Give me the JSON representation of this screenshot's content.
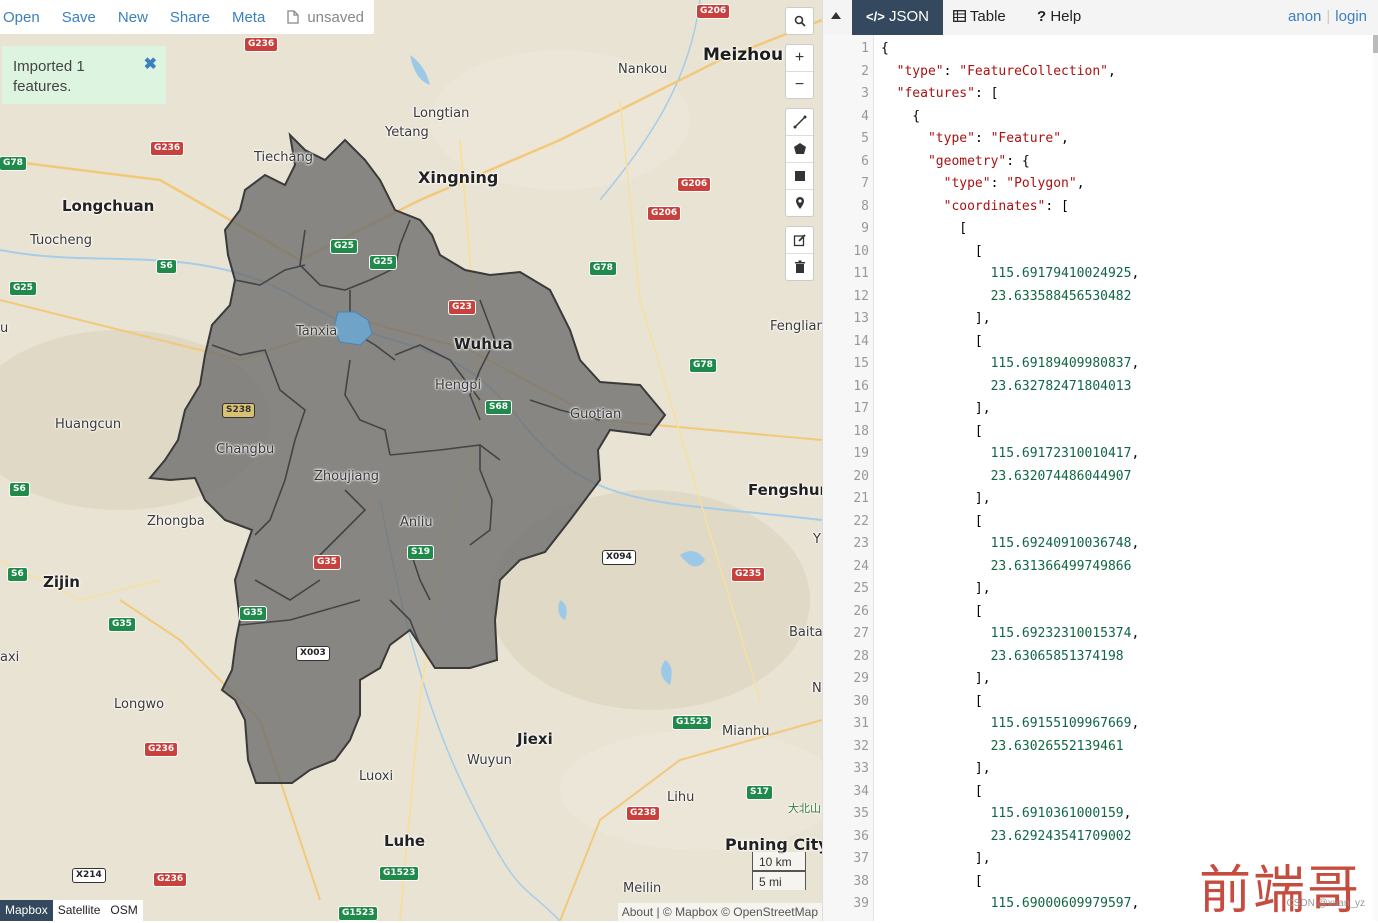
{
  "top_menu": {
    "items": [
      "Open",
      "Save",
      "New",
      "Share",
      "Meta"
    ],
    "file_status": "unsaved"
  },
  "notice": {
    "text": "Imported 1 features.",
    "close": "✖"
  },
  "map": {
    "places": {
      "meizhou": "Meizhou",
      "nankou": "Nankou",
      "longtian": "Longtian",
      "yetang": "Yetang",
      "tiechang": "Tiechang",
      "xingning": "Xingning",
      "longchuan": "Longchuan",
      "tuocheng": "Tuocheng",
      "tanxia": "Tanxia",
      "wuhua": "Wuhua",
      "hengpi": "Hengpi",
      "fengliang": "Fengliang",
      "guotian": "Guotian",
      "huangcun": "Huangcun",
      "changbu": "Changbu",
      "zhoujiang": "Zhoujiang",
      "fengshun": "Fengshun",
      "zhongba": "Zhongba",
      "anliu": "Anliu",
      "zijin": "Zijin",
      "baita": "Baita",
      "longwo": "Longwo",
      "mianhu": "Mianhu",
      "jiexi": "Jiexi",
      "wuyun": "Wuyun",
      "luoxi": "Luoxi",
      "lihu": "Lihu",
      "luhe": "Luhe",
      "puning": "Puning City",
      "meilin": "Meilin",
      "axi": "axi",
      "u": "u",
      "y": "Y",
      "n": "N",
      "dabeishan": "大北山"
    },
    "shields": {
      "g206a": "G206",
      "g236a": "G236",
      "g236b": "G236",
      "g078a": "G78",
      "g206b": "G206",
      "g206c": "G206",
      "g25a": "G25",
      "g25b": "G25",
      "g25c": "G25",
      "s6a": "S6",
      "s6b": "S6",
      "s6c": "S6",
      "g078b": "G78",
      "g078c": "G78",
      "g23": "G23",
      "s238": "S238",
      "s68": "S68",
      "s19": "S19",
      "g35a": "G35",
      "g35b": "G35",
      "g35c": "G35",
      "x094": "X094",
      "g235": "G235",
      "x003": "X003",
      "g1523a": "G1523",
      "g1523b": "G1523",
      "g1523c": "G1523",
      "g236c": "G236",
      "g236d": "G236",
      "s17": "S17",
      "g238": "G238",
      "x214": "X214"
    },
    "layers": [
      "Mapbox",
      "Satellite",
      "OSM"
    ],
    "active_layer": "Mapbox",
    "attribution": "About | © Mapbox © OpenStreetMap",
    "scale_km": "10 km",
    "scale_mi": "5 mi",
    "polygon_fill": "#666666",
    "polygon_stroke": "#333333"
  },
  "pane": {
    "tabs": [
      {
        "icon": "code-icon",
        "label": "JSON"
      },
      {
        "icon": "table-icon",
        "label": "Table"
      },
      {
        "icon": "help-icon",
        "label": "Help"
      }
    ],
    "active_tab": "JSON",
    "user": {
      "name": "anon",
      "login": "login"
    },
    "code_lines": [
      {
        "n": "1",
        "t": "{"
      },
      {
        "n": "2",
        "t": "  \"type\": \"FeatureCollection\","
      },
      {
        "n": "3",
        "t": "  \"features\": ["
      },
      {
        "n": "4",
        "t": "    {"
      },
      {
        "n": "5",
        "t": "      \"type\": \"Feature\","
      },
      {
        "n": "6",
        "t": "      \"geometry\": {"
      },
      {
        "n": "7",
        "t": "        \"type\": \"Polygon\","
      },
      {
        "n": "8",
        "t": "        \"coordinates\": ["
      },
      {
        "n": "9",
        "t": "          ["
      },
      {
        "n": "10",
        "t": "            ["
      },
      {
        "n": "11",
        "t": "              115.69179410024925,"
      },
      {
        "n": "12",
        "t": "              23.633588456530482"
      },
      {
        "n": "13",
        "t": "            ],"
      },
      {
        "n": "14",
        "t": "            ["
      },
      {
        "n": "15",
        "t": "              115.69189409980837,"
      },
      {
        "n": "16",
        "t": "              23.632782471804013"
      },
      {
        "n": "17",
        "t": "            ],"
      },
      {
        "n": "18",
        "t": "            ["
      },
      {
        "n": "19",
        "t": "              115.69172310010417,"
      },
      {
        "n": "20",
        "t": "              23.632074486044907"
      },
      {
        "n": "21",
        "t": "            ],"
      },
      {
        "n": "22",
        "t": "            ["
      },
      {
        "n": "23",
        "t": "              115.69240910036748,"
      },
      {
        "n": "24",
        "t": "              23.631366499749866"
      },
      {
        "n": "25",
        "t": "            ],"
      },
      {
        "n": "26",
        "t": "            ["
      },
      {
        "n": "27",
        "t": "              115.69232310015374,"
      },
      {
        "n": "28",
        "t": "              23.63065851374198"
      },
      {
        "n": "29",
        "t": "            ],"
      },
      {
        "n": "30",
        "t": "            ["
      },
      {
        "n": "31",
        "t": "              115.69155109967669,"
      },
      {
        "n": "32",
        "t": "              23.63026552139461"
      },
      {
        "n": "33",
        "t": "            ],"
      },
      {
        "n": "34",
        "t": "            ["
      },
      {
        "n": "35",
        "t": "              115.6910361000159,"
      },
      {
        "n": "36",
        "t": "              23.629243541709002"
      },
      {
        "n": "37",
        "t": "            ],"
      },
      {
        "n": "38",
        "t": "            ["
      },
      {
        "n": "39",
        "t": "              115.69000609979597,"
      }
    ]
  },
  "watermark": "前端哥",
  "csdn": "CSDN @xuan_yz"
}
